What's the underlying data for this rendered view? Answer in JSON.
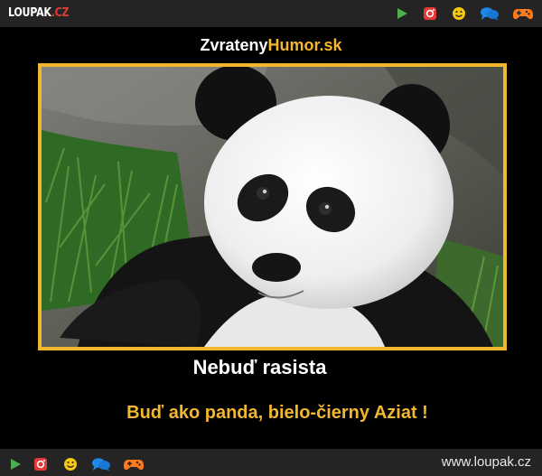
{
  "header": {
    "logo_main": "LOUPAK",
    "logo_suffix": ".CZ",
    "icons": [
      "play-icon",
      "instagram-icon",
      "smiley-icon",
      "chat-icon",
      "gamepad-icon"
    ]
  },
  "poster": {
    "site_name_part1": "Zvrateny",
    "site_name_part2": "Humor.sk",
    "headline": "Nebuď rasista",
    "subline": "Buď ako panda, bielo-čierny Aziat !",
    "image_subject": "panda"
  },
  "footer": {
    "icons": [
      "play-icon",
      "instagram-icon",
      "smiley-icon",
      "chat-icon",
      "gamepad-icon"
    ],
    "url": "www.loupak.cz"
  },
  "colors": {
    "accent": "#f3b72f",
    "bar_bg": "#242424",
    "logo_red": "#e53935",
    "play_green": "#4caf50",
    "insta_red": "#e53935",
    "smiley_yellow": "#f6c90e",
    "chat_blue": "#1e88e5",
    "gamepad_orange": "#ff7a1a"
  }
}
